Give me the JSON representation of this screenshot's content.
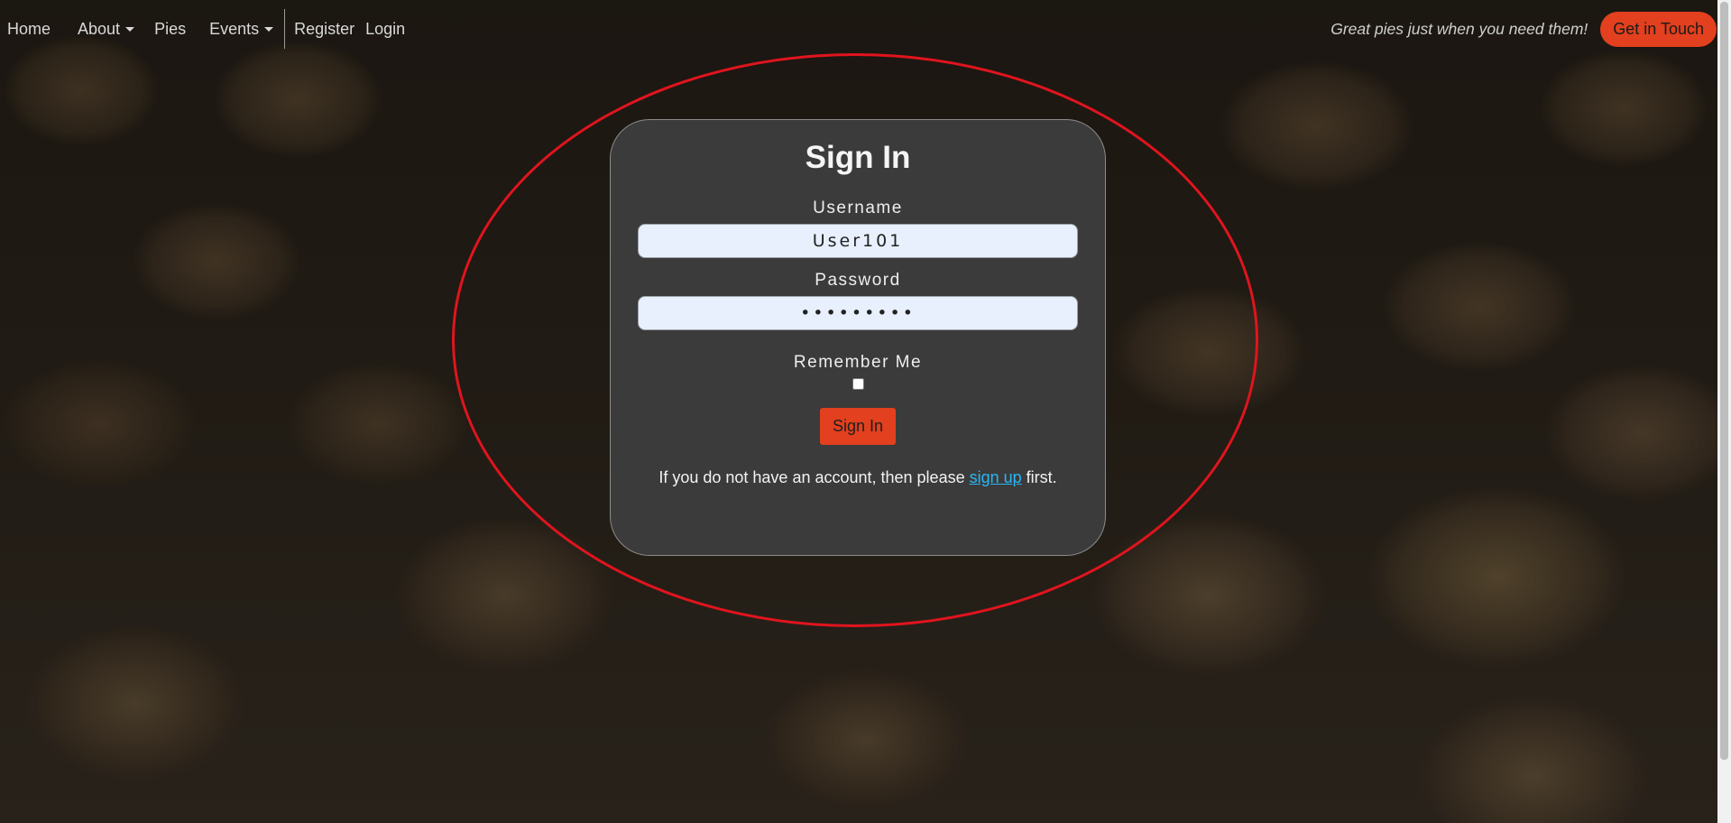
{
  "nav": {
    "items": [
      {
        "label": "Home"
      },
      {
        "label": "About"
      },
      {
        "label": "Pies"
      },
      {
        "label": "Events"
      },
      {
        "label": "Register"
      },
      {
        "label": "Login"
      }
    ],
    "tagline": "Great pies just when you need them!",
    "cta_label": "Get in Touch"
  },
  "form": {
    "title": "Sign In",
    "username_label": "Username",
    "username_value": "User101",
    "password_label": "Password",
    "password_value": "•••••••••",
    "remember_label": "Remember Me",
    "remember_checked": false,
    "submit_label": "Sign In",
    "note_before": "If you do not have an account, then please ",
    "note_link": "sign up",
    "note_after": " first."
  },
  "colors": {
    "accent": "#e2401e",
    "link": "#29b6f6",
    "highlight": "#e0141e",
    "card": "#3b3b3b"
  }
}
